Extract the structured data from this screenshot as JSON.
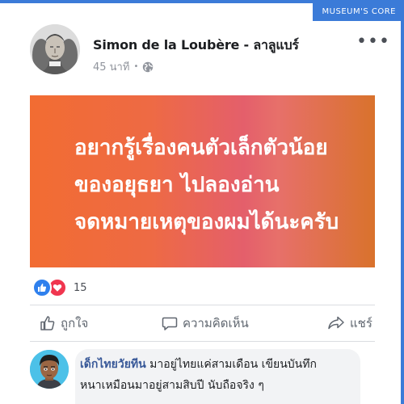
{
  "badge": {
    "label": "MUSEUM'S CORE"
  },
  "post": {
    "author": "Simon de la Loubère - ลาลูแบร์",
    "time": "45 นาที",
    "privacy_icon": "globe-icon",
    "more_icon": "more-options-icon",
    "banner": {
      "lines": [
        "อยากรู้เรื่องคนตัวเล็กตัวน้อย",
        "ของอยุธยา ไปลองอ่าน",
        "จดหมายเหตุของผมได้นะครับ"
      ],
      "gradient_colors": [
        "#f26c32",
        "#e45f6b",
        "#d9722c"
      ]
    },
    "reactions": {
      "icons": [
        "like-icon",
        "love-icon"
      ],
      "count": "15"
    },
    "actions": {
      "like_label": "ถูกใจ",
      "comment_label": "ความคิดเห็น",
      "share_label": "แชร์"
    }
  },
  "comment": {
    "name": "เด็กไทยวัยทีน",
    "text_line1": " มาอยู่ไทยแค่สามเดือน เขียนบันทึก",
    "text_line2": "หนาเหมือนมาอยู่สามสิบปี นับถือจริง ๆ"
  },
  "colors": {
    "accent": "#3b7bd8",
    "link": "#385898",
    "like": "#2f80ed",
    "love": "#f0364f"
  }
}
